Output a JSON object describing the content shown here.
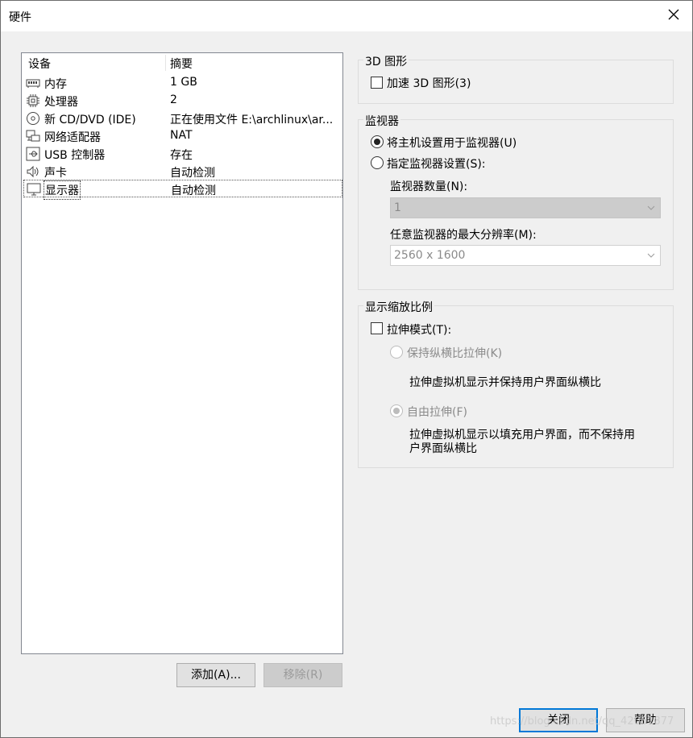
{
  "window": {
    "title": "硬件"
  },
  "device_list": {
    "headers": {
      "device": "设备",
      "summary": "摘要"
    },
    "rows": [
      {
        "name": "内存",
        "summary": "1 GB",
        "icon": "memory-icon"
      },
      {
        "name": "处理器",
        "summary": "2",
        "icon": "processor-icon"
      },
      {
        "name": "新 CD/DVD (IDE)",
        "summary": "正在使用文件 E:\\archlinux\\ar...",
        "icon": "cd-dvd-icon"
      },
      {
        "name": "网络适配器",
        "summary": "NAT",
        "icon": "network-adapter-icon"
      },
      {
        "name": "USB 控制器",
        "summary": "存在",
        "icon": "usb-controller-icon"
      },
      {
        "name": "声卡",
        "summary": "自动检测",
        "icon": "sound-card-icon"
      },
      {
        "name": "显示器",
        "summary": "自动检测",
        "icon": "display-icon",
        "selected": true
      }
    ],
    "add_button": "添加(A)...",
    "remove_button": "移除(R)"
  },
  "graphics_3d": {
    "title": "3D 图形",
    "accelerate_label": "加速 3D 图形(3)",
    "accelerate_checked": false
  },
  "monitors": {
    "title": "监视器",
    "use_host_label": "将主机设置用于监视器(U)",
    "specify_label": "指定监视器设置(S):",
    "selected": "use_host",
    "count_label": "监视器数量(N):",
    "count_value": "1",
    "max_res_label": "任意监视器的最大分辨率(M):",
    "max_res_value": "2560 x 1600"
  },
  "scaling": {
    "title": "显示缩放比例",
    "stretch_label": "拉伸模式(T):",
    "stretch_checked": false,
    "keep_aspect_label": "保持纵横比拉伸(K)",
    "keep_aspect_desc": "拉伸虚拟机显示并保持用户界面纵横比",
    "free_stretch_label": "自由拉伸(F)",
    "free_stretch_desc_line1": "拉伸虚拟机显示以填充用户界面，而不保持用",
    "free_stretch_desc_line2": "户界面纵横比"
  },
  "footer": {
    "close_button": "关闭",
    "help_button": "帮助",
    "watermark": "https://blog.csdn.net/qq_42061877"
  },
  "colors": {
    "accent": "#0078d7",
    "window_bg": "#f0f0f0"
  }
}
